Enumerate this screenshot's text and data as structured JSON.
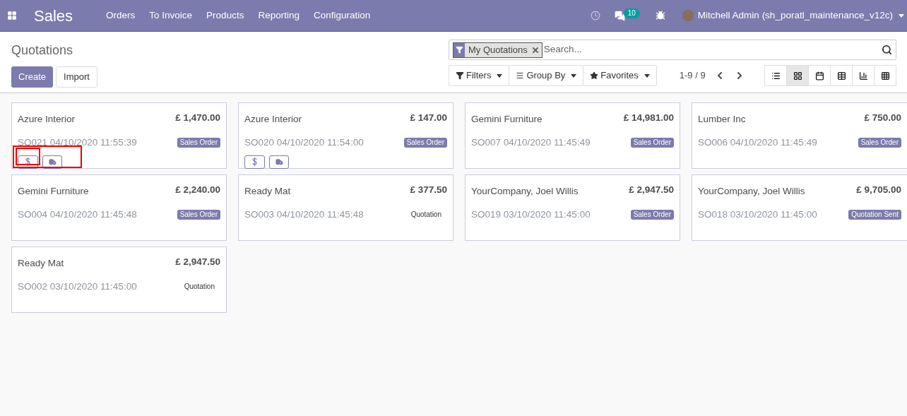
{
  "navbar": {
    "app": "Sales",
    "menu": [
      "Orders",
      "To Invoice",
      "Products",
      "Reporting",
      "Configuration"
    ],
    "message_count": "10",
    "user": "Mitchell Admin (sh_poratl_maintenance_v12c)"
  },
  "control_panel": {
    "title": "Quotations",
    "buttons": [
      {
        "label": "Create",
        "kind": "primary"
      },
      {
        "label": "Import",
        "kind": "secondary"
      }
    ],
    "search": {
      "facet": "My Quotations",
      "placeholder": "Search..."
    },
    "dropdowns": [
      {
        "label": "Filters",
        "kind": "filter"
      },
      {
        "label": "Group By",
        "kind": "group"
      },
      {
        "label": "Favorites",
        "kind": "star"
      }
    ],
    "pager": "1-9 / 9",
    "views": [
      {
        "kind": "list",
        "selected": false
      },
      {
        "kind": "kanban",
        "selected": true
      },
      {
        "kind": "calendar",
        "selected": false
      },
      {
        "kind": "pivot",
        "selected": false
      },
      {
        "kind": "graph",
        "selected": false
      },
      {
        "kind": "grid",
        "selected": false
      }
    ]
  },
  "cards": [
    {
      "customer": "Azure Interior",
      "amount": "£ 1,470.00",
      "reference": "SO021 04/10/2020 11:55:39",
      "status": "Sales Order",
      "status_badge": true,
      "actions": true,
      "annotated": true
    },
    {
      "customer": "Azure Interior",
      "amount": "£ 147.00",
      "reference": "SO020 04/10/2020 11:54:00",
      "status": "Sales Order",
      "status_badge": true,
      "actions": true,
      "annotated": false
    },
    {
      "customer": "Gemini Furniture",
      "amount": "£ 14,981.00",
      "reference": "SO007 04/10/2020 11:45:49",
      "status": "Sales Order",
      "status_badge": true,
      "actions": false,
      "annotated": false
    },
    {
      "customer": "Lumber Inc",
      "amount": "£ 750.00",
      "reference": "SO006 04/10/2020 11:45:49",
      "status": "Sales Order",
      "status_badge": true,
      "actions": false,
      "annotated": false
    },
    {
      "customer": "Gemini Furniture",
      "amount": "£ 2,240.00",
      "reference": "SO004 04/10/2020 11:45:48",
      "status": "Sales Order",
      "status_badge": true,
      "actions": false,
      "annotated": false
    },
    {
      "customer": "Ready Mat",
      "amount": "£ 377.50",
      "reference": "SO003 04/10/2020 11:45:48",
      "status": "Quotation",
      "status_badge": false,
      "actions": false,
      "annotated": false
    },
    {
      "customer": "YourCompany, Joel Willis",
      "amount": "£ 2,947.50",
      "reference": "SO019 03/10/2020 11:45:00",
      "status": "Sales Order",
      "status_badge": true,
      "actions": false,
      "annotated": false
    },
    {
      "customer": "YourCompany, Joel Willis",
      "amount": "£ 9,705.00",
      "reference": "SO018 03/10/2020 11:45:00",
      "status": "Quotation Sent",
      "status_badge": true,
      "actions": false,
      "annotated": false
    },
    {
      "customer": "Ready Mat",
      "amount": "£ 2,947.50",
      "reference": "SO002 03/10/2020 11:45:00",
      "status": "Quotation",
      "status_badge": false,
      "actions": false,
      "annotated": false
    }
  ]
}
